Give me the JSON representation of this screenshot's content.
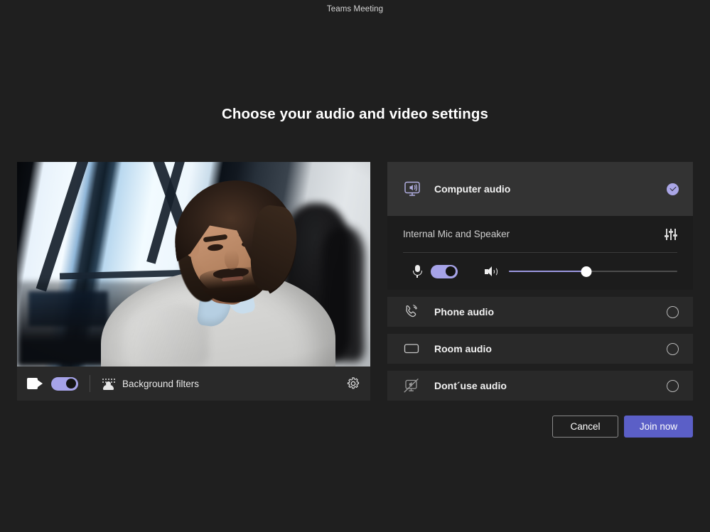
{
  "window": {
    "title": "Teams Meeting"
  },
  "heading": "Choose your audio and video settings",
  "video": {
    "camera_icon": "camera-icon",
    "camera_toggle_state": "on",
    "background_filters_label": "Background filters",
    "background_filters_icon": "background-filters-icon",
    "settings_icon": "gear-icon"
  },
  "audio": {
    "options": [
      {
        "id": "computer-audio",
        "label": "Computer audio",
        "icon": "computer-audio-icon",
        "selected": true
      },
      {
        "id": "phone-audio",
        "label": "Phone audio",
        "icon": "phone-audio-icon",
        "selected": false
      },
      {
        "id": "room-audio",
        "label": "Room audio",
        "icon": "room-audio-icon",
        "selected": false
      },
      {
        "id": "dont-use-audio",
        "label": "Dont´use audio",
        "icon": "no-audio-icon",
        "selected": false
      }
    ],
    "device": {
      "name": "Internal Mic and Speaker",
      "settings_icon": "equalizer-icon"
    },
    "mic": {
      "icon": "microphone-icon",
      "toggle_state": "on"
    },
    "speaker": {
      "icon": "speaker-icon",
      "volume_percent": 46
    }
  },
  "actions": {
    "cancel_label": "Cancel",
    "join_label": "Join now"
  },
  "colors": {
    "accent_purple": "#5b5fc7",
    "toggle_purple": "#a6a3e8",
    "page_background": "#1f1f1f",
    "row_background": "#292929",
    "row_selected_background": "#333333"
  }
}
